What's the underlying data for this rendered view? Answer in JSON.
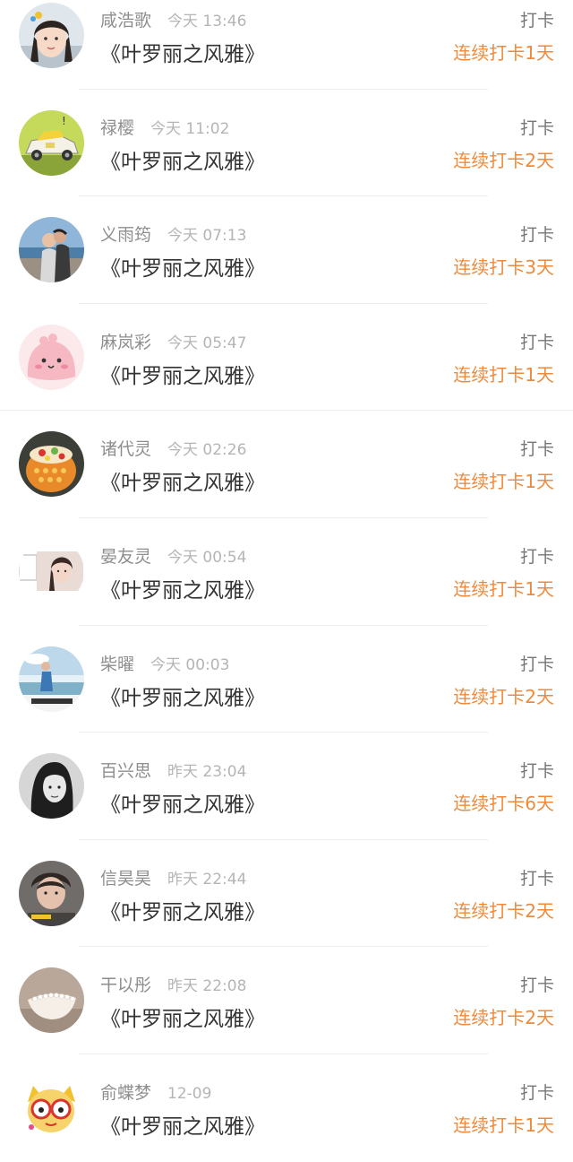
{
  "checkins": [
    {
      "name": "咸浩歌",
      "time": "今天 13:46",
      "title": "《叶罗丽之风雅》",
      "action": "打卡",
      "streak": "连续打卡1天",
      "avatar": "girl-portrait-avatar"
    },
    {
      "name": "禄樱",
      "time": "今天 11:02",
      "title": "《叶罗丽之风雅》",
      "action": "打卡",
      "streak": "连续打卡2天",
      "avatar": "toy-car-avatar"
    },
    {
      "name": "义雨筠",
      "time": "今天 07:13",
      "title": "《叶罗丽之风雅》",
      "action": "打卡",
      "streak": "连续打卡3天",
      "avatar": "couple-seaside-avatar"
    },
    {
      "name": "麻岚彩",
      "time": "今天 05:47",
      "title": "《叶罗丽之风雅》",
      "action": "打卡",
      "streak": "连续打卡1天",
      "avatar": "pink-cartoon-avatar"
    },
    {
      "name": "诸代灵",
      "time": "今天 02:26",
      "title": "《叶罗丽之风雅》",
      "action": "打卡",
      "streak": "连续打卡1天",
      "avatar": "fruit-cake-avatar"
    },
    {
      "name": "晏友灵",
      "time": "今天 00:54",
      "title": "《叶罗丽之风雅》",
      "action": "打卡",
      "streak": "连续打卡1天",
      "avatar": "girl-photo-avatar"
    },
    {
      "name": "柴曜",
      "time": "今天 00:03",
      "title": "《叶罗丽之风雅》",
      "action": "打卡",
      "streak": "连续打卡2天",
      "avatar": "sky-person-avatar"
    },
    {
      "name": "百兴思",
      "time": "昨天 23:04",
      "title": "《叶罗丽之风雅》",
      "action": "打卡",
      "streak": "连续打卡6天",
      "avatar": "bw-woman-avatar"
    },
    {
      "name": "信昊昊",
      "time": "昨天 22:44",
      "title": "《叶罗丽之风雅》",
      "action": "打卡",
      "streak": "连续打卡2天",
      "avatar": "boy-selfie-avatar"
    },
    {
      "name": "干以彤",
      "time": "昨天 22:08",
      "title": "《叶罗丽之风雅》",
      "action": "打卡",
      "streak": "连续打卡2天",
      "avatar": "shell-object-avatar"
    },
    {
      "name": "俞蝶梦",
      "time": "12-09",
      "title": "《叶罗丽之风雅》",
      "action": "打卡",
      "streak": "连续打卡1天",
      "avatar": "cartoon-character-avatar"
    }
  ],
  "colors": {
    "name": "#8e8e8e",
    "time": "#b5b5b5",
    "title": "#333333",
    "action": "#777777",
    "streak": "#ee8a3c"
  }
}
